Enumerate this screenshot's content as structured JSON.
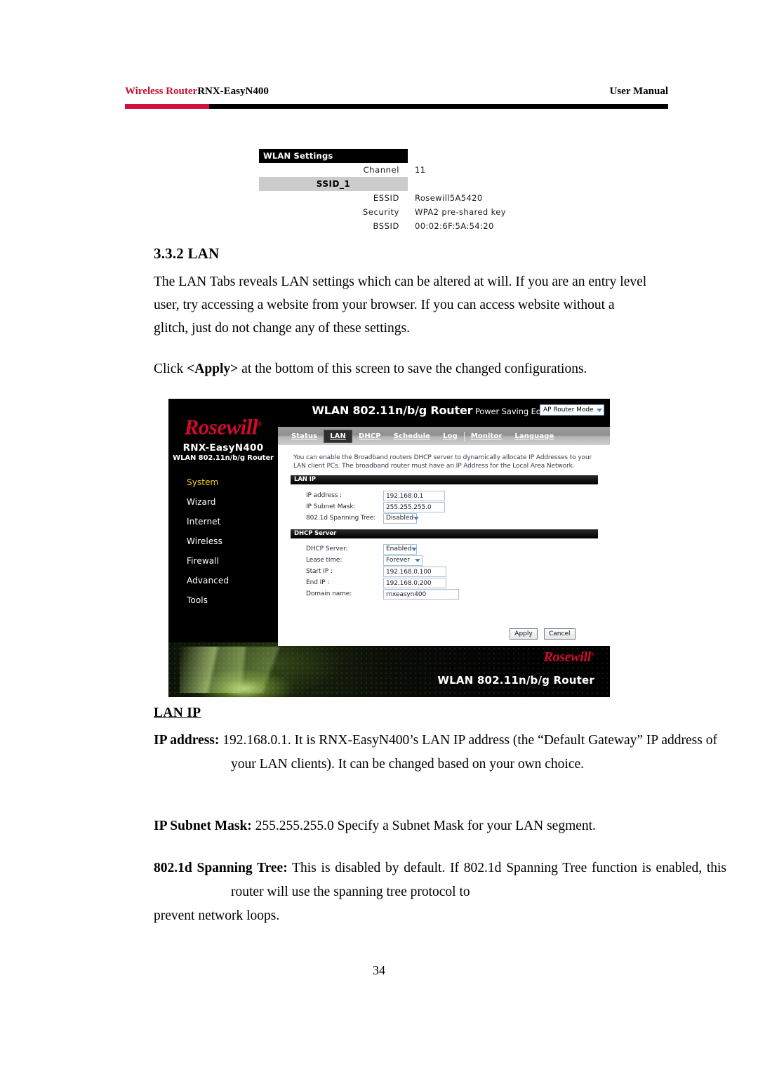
{
  "header": {
    "left_brand": "Wireless Router",
    "left_model": "RNX-EasyN400",
    "right": "User Manual",
    "rule_red": "#d3123c",
    "rule_black": "#000000"
  },
  "wlan_settings": {
    "title": "WLAN Settings",
    "channel_label": "Channel",
    "channel_value": "11",
    "ssid_group": "SSID_1",
    "rows": [
      {
        "label": "ESSID",
        "value": "Rosewill5A5420"
      },
      {
        "label": "Security",
        "value": "WPA2 pre-shared key"
      },
      {
        "label": "BSSID",
        "value": "00:02:6F:5A:54:20"
      }
    ]
  },
  "section": {
    "heading": "3.3.2 LAN",
    "intro_paragraph": "The LAN Tabs reveals LAN settings which can be altered at will. If you are an entry level user, try accessing a website from your browser. If you can access website without a glitch, just do not change any of these settings.",
    "click_prefix": "Click ",
    "click_bold": "<Apply>",
    "click_suffix": " at the bottom of this screen to save the changed configurations."
  },
  "lan_ip_doc": {
    "heading": "LAN IP",
    "ip_address_label": "IP address:",
    "ip_address_text": " 192.168.0.1. It is RNX-EasyN400’s LAN IP address (the “Default Gateway” IP address of your LAN clients). It can be changed based on your own choice.",
    "subnet_label": "IP Subnet Mask:",
    "subnet_text": " 255.255.255.0 Specify a Subnet Mask for your LAN segment.",
    "stp_label": "802.1d Spanning Tree:",
    "stp_text": " This is disabled by default. If 802.1d Spanning Tree function is enabled, this router will use the spanning tree protocol to",
    "stp_text_last": "prevent network loops."
  },
  "page_number": "34",
  "router_ui": {
    "title_main": "WLAN 802.11n/b/g Router",
    "title_sub": " Power Saving Edition",
    "mode_select_value": "AP Router Mode",
    "brand_logo": "Rosewill",
    "model_name": "RNX-EasyN400",
    "model_sub": "WLAN 802.11n/b/g Router",
    "menu": [
      {
        "label": "System",
        "active": true
      },
      {
        "label": "Wizard",
        "active": false
      },
      {
        "label": "Internet",
        "active": false
      },
      {
        "label": "Wireless",
        "active": false
      },
      {
        "label": "Firewall",
        "active": false
      },
      {
        "label": "Advanced",
        "active": false
      },
      {
        "label": "Tools",
        "active": false
      }
    ],
    "tabs": [
      {
        "label": "Status",
        "active": false
      },
      {
        "label": "LAN",
        "active": true
      },
      {
        "label": "DHCP",
        "active": false
      },
      {
        "label": "Schedule",
        "active": false
      },
      {
        "label": "Log",
        "active": false
      },
      {
        "label": "Monitor",
        "active": false
      },
      {
        "label": "Language",
        "active": false
      }
    ],
    "description": "You can enable the Broadband routers DHCP server to dynamically allocate IP Addresses to your LAN client PCs. The broadband router must have an IP Address for the Local Area Network.",
    "lan_ip_section": {
      "bar_title": "LAN IP",
      "ip_address_label": "IP address :",
      "ip_address_value": "192.168.0.1",
      "subnet_label": "IP Subnet Mask:",
      "subnet_value": "255.255.255.0",
      "stp_label": "802.1d Spanning Tree:",
      "stp_value": "Disabled"
    },
    "dhcp_section": {
      "bar_title": "DHCP Server",
      "dhcp_label": "DHCP Server:",
      "dhcp_value": "Enabled",
      "lease_label": "Lease time:",
      "lease_value": "Forever",
      "start_ip_label": "Start IP :",
      "start_ip_value": "192.168.0.100",
      "end_ip_label": "End IP :",
      "end_ip_value": "192.168.0.200",
      "domain_label": "Domain name:",
      "domain_value": "rnxeasyn400"
    },
    "apply_button": "Apply",
    "cancel_button": "Cancel",
    "banner_logo": "Rosewill",
    "banner_text": "WLAN 802.11n/b/g Router"
  },
  "colors": {
    "brand_red": "#cf0a2c",
    "header_red": "#c8102e",
    "menu_active_yellow": "#f2d024"
  }
}
